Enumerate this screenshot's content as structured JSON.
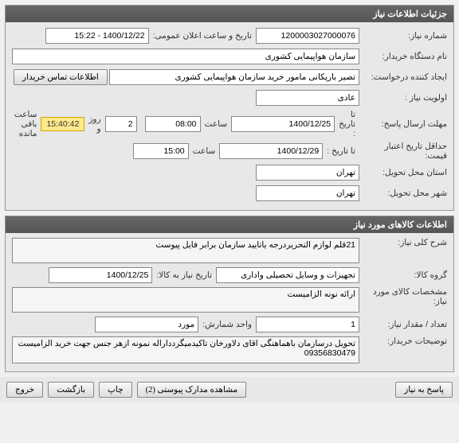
{
  "panel1": {
    "title": "جزئیات اطلاعات نیاز",
    "need_no_label": "شماره نیاز:",
    "need_no": "1200003027000076",
    "announce_label": "تاریخ و ساعت اعلان عمومی:",
    "announce_val": "1400/12/22 - 15:22",
    "buyer_label": "نام دستگاه خریدار:",
    "buyer_val": "سازمان هواپیمایی کشوری",
    "requester_label": "ایجاد کننده درخواست:",
    "requester_val": "تصیر باریکانی مامور خرید سازمان هواپیمایی کشوری",
    "contact_btn": "اطلاعات تماس خریدار",
    "priority_label": "اولویت نیاز :",
    "priority_val": "عادی",
    "reply_deadline_label": "مهلت ارسال پاسخ:",
    "to_date_label": "تا تاریخ :",
    "reply_date": "1400/12/25",
    "time_label": "ساعت",
    "reply_time": "08:00",
    "days_val": "2",
    "days_and": "روز و",
    "remaining_time": "15:40:42",
    "remaining_label": "ساعت باقی مانده",
    "price_valid_label": "حداقل تاریخ اعتبار قیمت:",
    "price_valid_date": "1400/12/29",
    "price_valid_time": "15:00",
    "delivery_province_label": "استان محل تحویل:",
    "delivery_province": "تهران",
    "delivery_city_label": "شهر محل تحویل:",
    "delivery_city": "تهران"
  },
  "panel2": {
    "title": "اطلاعات کالاهای مورد نیاز",
    "desc_label": "شرح کلی نیاز:",
    "desc_val": "21قلم لوازم التحریردرجه یاتایید سازمان برابر فایل پیوست",
    "group_label": "گروه کالا:",
    "group_val": "تجهیزات و وسایل تحصیلی واداری",
    "need_date_label": "تاریخ نیاز به کالا:",
    "need_date_val": "1400/12/25",
    "spec_label": "مشخصات کالای مورد نیاز:",
    "spec_val": "ارائه نونه الزامیست",
    "qty_label": "تعداد / مقدار نیاز:",
    "qty_val": "1",
    "unit_label": "واحد شمارش:",
    "unit_val": "مورد",
    "buyer_notes_label": "توضیحات خریدار:",
    "buyer_notes_val": "تحویل درسازمان باهماهنگی اقای دلاورخان تاکیدمیگردداراله نمونه ازهر جنس جهت خرید الزامیست 09356830479"
  },
  "footer": {
    "reply": "پاسخ به نیاز",
    "attachments": "مشاهده مدارک پیوستی (2)",
    "print": "چاپ",
    "back": "بازگشت",
    "exit": "خروج"
  }
}
